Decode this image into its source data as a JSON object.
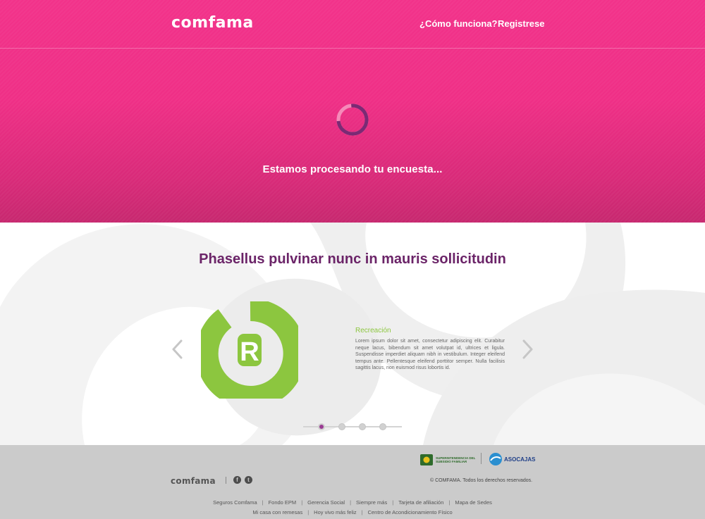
{
  "header": {
    "logo_text": "comfama",
    "nav": [
      {
        "label": "¿Cómo funciona?"
      },
      {
        "label": "Registrese"
      }
    ]
  },
  "hero": {
    "status_text": "Estamos procesando tu encuesta...",
    "spinner_colors": {
      "track": "#f58ab9",
      "arc": "#7b2a74"
    }
  },
  "main": {
    "title": "Phasellus pulvinar nunc in mauris sollicitudin",
    "slide": {
      "badge_letter": "R",
      "badge_color": "#8cc63f",
      "category": "Recreación",
      "text": "Lorem ipsum dolor sit amet, consectetur adipiscing elit. Curabitur neque lacus, bibendum sit amet volutpat id, ultrices et ligula. Suspendisse imperdiet aliquam nibh in vestibulum. Integer eleifend tempus ante. Pellentesque eleifend porttitor semper. Nulla facilisis sagittis lacus, non euismod risus lobortis id."
    },
    "pagination": {
      "total": 4,
      "active": 1
    },
    "arrows": {
      "prev_icon": "chevron-left-icon",
      "next_icon": "chevron-right-icon"
    }
  },
  "footer": {
    "partner_1": "SUPERINTENDENCIA DEL SUBSIDIO FAMILIAR",
    "partner_2": "ASOCAJAS",
    "logo_text": "comfama",
    "social": [
      {
        "icon": "facebook-icon",
        "glyph": "f"
      },
      {
        "icon": "twitter-icon",
        "glyph": "t"
      }
    ],
    "copyright": "© COMFAMA. Todos los derechos reservados.",
    "links_row_1": [
      "Seguros Comfama",
      "Fondo EPM",
      "Gerencia Social",
      "Siempre más",
      "Tarjeta de afiliación",
      "Mapa de Sedes"
    ],
    "links_row_2": [
      "Mi casa con remesas",
      "Hoy vivo más feliz",
      "Centro de Acondicionamiento Físico"
    ]
  },
  "colors": {
    "brand_pink": "#f2328a",
    "title_purple": "#6b2468",
    "accent_green": "#8cc63f",
    "footer_gray": "#cbcbcb"
  }
}
